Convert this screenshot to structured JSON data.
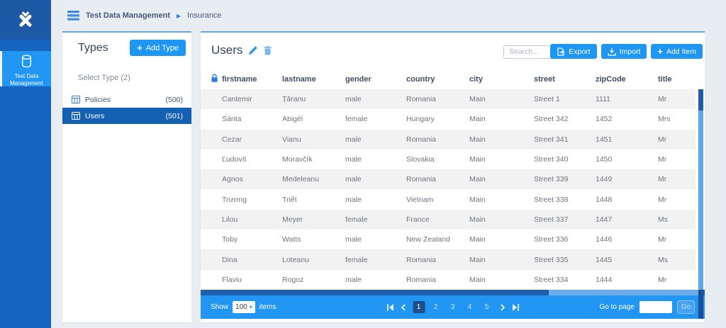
{
  "sidebar": {
    "active_item": {
      "line1": "Test Data",
      "line2": "Management"
    }
  },
  "breadcrumb": {
    "root": "Test Data Management",
    "current": "Insurance"
  },
  "types_panel": {
    "title": "Types",
    "add_type_label": "Add Type",
    "select_type_label": "Select Type (2)",
    "items": [
      {
        "label": "Policies",
        "count": "(500)",
        "active": false
      },
      {
        "label": "Users",
        "count": "(501)",
        "active": true
      }
    ]
  },
  "users_panel": {
    "title": "Users",
    "search_placeholder": "Search...",
    "buttons": {
      "export": "Export",
      "import": "Import",
      "add_item": "Add Item"
    },
    "table": {
      "columns": [
        "firstname",
        "lastname",
        "gender",
        "country",
        "city",
        "street",
        "zipCode",
        "title"
      ],
      "rows": [
        [
          "Cantemir",
          "Țăranu",
          "male",
          "Romania",
          "Main",
          "Street 1",
          "1111",
          "Mr"
        ],
        [
          "Sánta",
          "Abigél",
          "female",
          "Hungary",
          "Main",
          "Street 342",
          "1452",
          "Mrs"
        ],
        [
          "Cezar",
          "Vianu",
          "male",
          "Romania",
          "Main",
          "Street 341",
          "1451",
          "Mr"
        ],
        [
          "Ľudovít",
          "Moravčík",
          "male",
          "Slovakia",
          "Main",
          "Street 340",
          "1450",
          "Mr"
        ],
        [
          "Agnos",
          "Medeleanu",
          "male",
          "Romania",
          "Main",
          "Street 339",
          "1449",
          "Mr"
        ],
        [
          "Trương",
          "Triết",
          "male",
          "Vietnam",
          "Main",
          "Street 338",
          "1448",
          "Mr"
        ],
        [
          "Lilou",
          "Meyer",
          "female",
          "France",
          "Main",
          "Street 337",
          "1447",
          "Ms"
        ],
        [
          "Toby",
          "Watts",
          "male",
          "New Zealand",
          "Main",
          "Street 336",
          "1446",
          "Mr"
        ],
        [
          "Dina",
          "Loteanu",
          "female",
          "Romania",
          "Main",
          "Street 335",
          "1445",
          "Ms"
        ],
        [
          "Flaviu",
          "Rogoz",
          "male",
          "Romania",
          "Main",
          "Street 334",
          "1444",
          "Mr"
        ]
      ]
    },
    "pagination": {
      "show_label": "Show",
      "page_size": "100",
      "items_label": "items",
      "pages": [
        "1",
        "2",
        "3",
        "4",
        "5"
      ],
      "active_page": "1",
      "goto_label": "Go to page",
      "go_label": "Go"
    }
  },
  "colors": {
    "accent": "#2196f3",
    "rail": "#1565c0",
    "selected_item": "#1460b2",
    "active_page": "#1c4e8a",
    "card_top_border": "#69a6dd",
    "pagination_bar": "#2296f3"
  }
}
